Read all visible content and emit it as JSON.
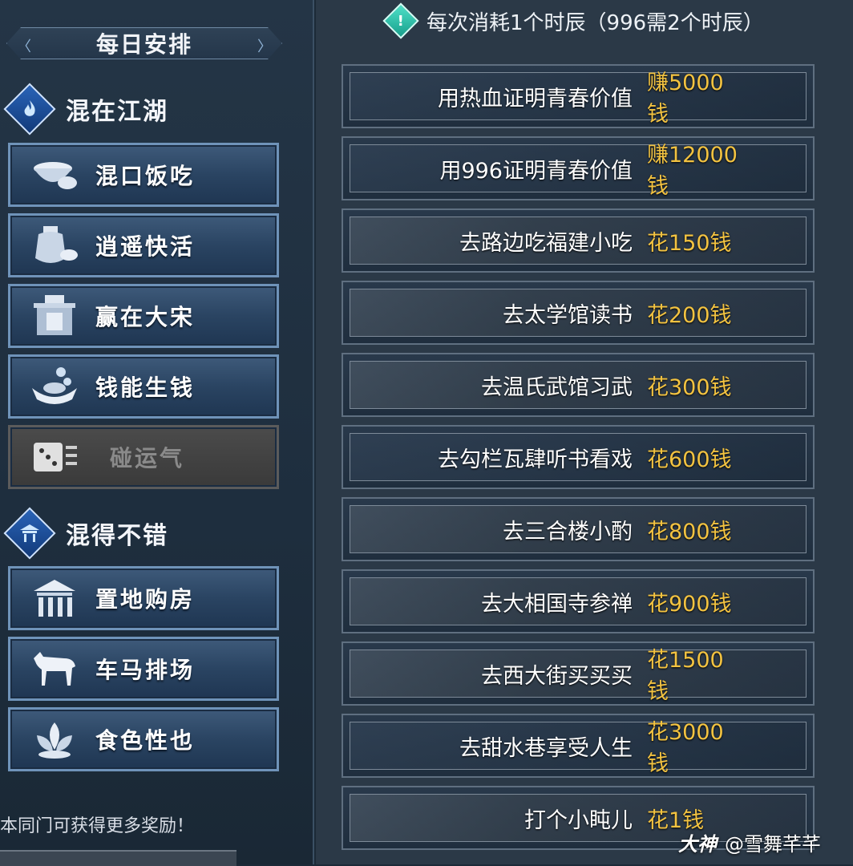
{
  "daily": {
    "title": "每日安排"
  },
  "sections": [
    {
      "title": "混在江湖",
      "icon": "flame-icon"
    },
    {
      "title": "混得不错",
      "icon": "pavilion-icon"
    }
  ],
  "categories": [
    {
      "label": "混口饭吃",
      "icon": "rice-bowl-icon",
      "enabled": true
    },
    {
      "label": "逍遥快活",
      "icon": "wine-jar-icon",
      "enabled": true
    },
    {
      "label": "赢在大宋",
      "icon": "shop-icon",
      "enabled": true
    },
    {
      "label": "钱能生钱",
      "icon": "gold-ingot-icon",
      "enabled": true
    },
    {
      "label": "碰运气",
      "icon": "dice-icon",
      "enabled": false
    },
    {
      "label": "置地购房",
      "icon": "house-icon",
      "enabled": true
    },
    {
      "label": "车马排场",
      "icon": "horse-icon",
      "enabled": true
    },
    {
      "label": "食色性也",
      "icon": "lotus-icon",
      "enabled": true
    }
  ],
  "footer_note": "本同门可获得更多奖励！",
  "notice": {
    "text": "每次消耗1个时辰（996需2个时辰）",
    "icon": "exclamation-gem-icon"
  },
  "activities": [
    {
      "name": "用热血证明青春价值",
      "price": "赚5000钱"
    },
    {
      "name": "用996证明青春价值",
      "price": "赚12000钱"
    },
    {
      "name": "去路边吃福建小吃",
      "price": "花150钱"
    },
    {
      "name": "去太学馆读书",
      "price": "花200钱"
    },
    {
      "name": "去温氏武馆习武",
      "price": "花300钱"
    },
    {
      "name": "去勾栏瓦肆听书看戏",
      "price": "花600钱"
    },
    {
      "name": "去三合楼小酌",
      "price": "花800钱"
    },
    {
      "name": "去大相国寺参禅",
      "price": "花900钱"
    },
    {
      "name": "去西大街买买买",
      "price": "花1500钱"
    },
    {
      "name": "去甜水巷享受人生",
      "price": "花3000钱"
    },
    {
      "name": "打个小盹儿",
      "price": "花1钱"
    }
  ],
  "watermark": {
    "logo": "大神",
    "handle": "@雪舞芊芊"
  },
  "colors": {
    "price": "#f3c341",
    "panel": "#1e2e3e",
    "button_border": "#6f93b9"
  }
}
